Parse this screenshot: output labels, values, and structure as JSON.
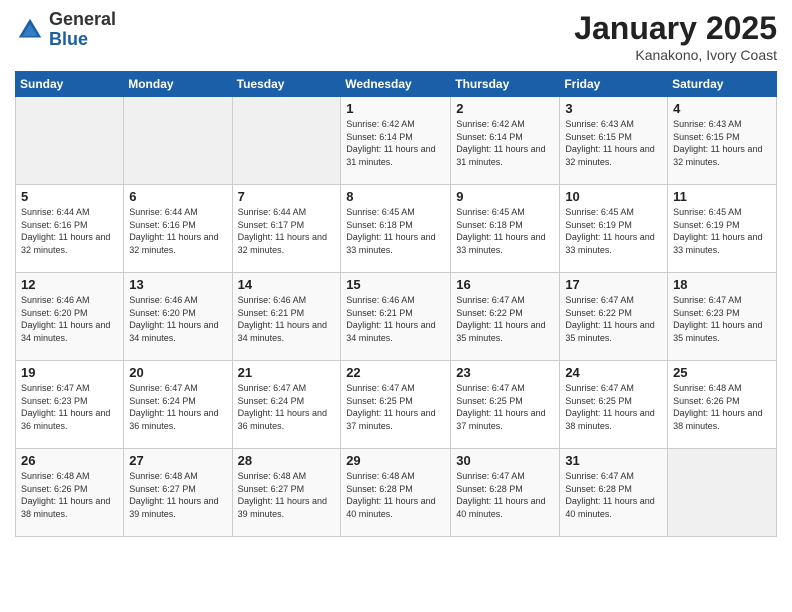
{
  "header": {
    "logo_line1": "General",
    "logo_line2": "Blue",
    "month": "January 2025",
    "location": "Kanakono, Ivory Coast"
  },
  "weekdays": [
    "Sunday",
    "Monday",
    "Tuesday",
    "Wednesday",
    "Thursday",
    "Friday",
    "Saturday"
  ],
  "weeks": [
    [
      {
        "day": "",
        "sunrise": "",
        "sunset": "",
        "daylight": ""
      },
      {
        "day": "",
        "sunrise": "",
        "sunset": "",
        "daylight": ""
      },
      {
        "day": "",
        "sunrise": "",
        "sunset": "",
        "daylight": ""
      },
      {
        "day": "1",
        "sunrise": "Sunrise: 6:42 AM",
        "sunset": "Sunset: 6:14 PM",
        "daylight": "Daylight: 11 hours and 31 minutes."
      },
      {
        "day": "2",
        "sunrise": "Sunrise: 6:42 AM",
        "sunset": "Sunset: 6:14 PM",
        "daylight": "Daylight: 11 hours and 31 minutes."
      },
      {
        "day": "3",
        "sunrise": "Sunrise: 6:43 AM",
        "sunset": "Sunset: 6:15 PM",
        "daylight": "Daylight: 11 hours and 32 minutes."
      },
      {
        "day": "4",
        "sunrise": "Sunrise: 6:43 AM",
        "sunset": "Sunset: 6:15 PM",
        "daylight": "Daylight: 11 hours and 32 minutes."
      }
    ],
    [
      {
        "day": "5",
        "sunrise": "Sunrise: 6:44 AM",
        "sunset": "Sunset: 6:16 PM",
        "daylight": "Daylight: 11 hours and 32 minutes."
      },
      {
        "day": "6",
        "sunrise": "Sunrise: 6:44 AM",
        "sunset": "Sunset: 6:16 PM",
        "daylight": "Daylight: 11 hours and 32 minutes."
      },
      {
        "day": "7",
        "sunrise": "Sunrise: 6:44 AM",
        "sunset": "Sunset: 6:17 PM",
        "daylight": "Daylight: 11 hours and 32 minutes."
      },
      {
        "day": "8",
        "sunrise": "Sunrise: 6:45 AM",
        "sunset": "Sunset: 6:18 PM",
        "daylight": "Daylight: 11 hours and 33 minutes."
      },
      {
        "day": "9",
        "sunrise": "Sunrise: 6:45 AM",
        "sunset": "Sunset: 6:18 PM",
        "daylight": "Daylight: 11 hours and 33 minutes."
      },
      {
        "day": "10",
        "sunrise": "Sunrise: 6:45 AM",
        "sunset": "Sunset: 6:19 PM",
        "daylight": "Daylight: 11 hours and 33 minutes."
      },
      {
        "day": "11",
        "sunrise": "Sunrise: 6:45 AM",
        "sunset": "Sunset: 6:19 PM",
        "daylight": "Daylight: 11 hours and 33 minutes."
      }
    ],
    [
      {
        "day": "12",
        "sunrise": "Sunrise: 6:46 AM",
        "sunset": "Sunset: 6:20 PM",
        "daylight": "Daylight: 11 hours and 34 minutes."
      },
      {
        "day": "13",
        "sunrise": "Sunrise: 6:46 AM",
        "sunset": "Sunset: 6:20 PM",
        "daylight": "Daylight: 11 hours and 34 minutes."
      },
      {
        "day": "14",
        "sunrise": "Sunrise: 6:46 AM",
        "sunset": "Sunset: 6:21 PM",
        "daylight": "Daylight: 11 hours and 34 minutes."
      },
      {
        "day": "15",
        "sunrise": "Sunrise: 6:46 AM",
        "sunset": "Sunset: 6:21 PM",
        "daylight": "Daylight: 11 hours and 34 minutes."
      },
      {
        "day": "16",
        "sunrise": "Sunrise: 6:47 AM",
        "sunset": "Sunset: 6:22 PM",
        "daylight": "Daylight: 11 hours and 35 minutes."
      },
      {
        "day": "17",
        "sunrise": "Sunrise: 6:47 AM",
        "sunset": "Sunset: 6:22 PM",
        "daylight": "Daylight: 11 hours and 35 minutes."
      },
      {
        "day": "18",
        "sunrise": "Sunrise: 6:47 AM",
        "sunset": "Sunset: 6:23 PM",
        "daylight": "Daylight: 11 hours and 35 minutes."
      }
    ],
    [
      {
        "day": "19",
        "sunrise": "Sunrise: 6:47 AM",
        "sunset": "Sunset: 6:23 PM",
        "daylight": "Daylight: 11 hours and 36 minutes."
      },
      {
        "day": "20",
        "sunrise": "Sunrise: 6:47 AM",
        "sunset": "Sunset: 6:24 PM",
        "daylight": "Daylight: 11 hours and 36 minutes."
      },
      {
        "day": "21",
        "sunrise": "Sunrise: 6:47 AM",
        "sunset": "Sunset: 6:24 PM",
        "daylight": "Daylight: 11 hours and 36 minutes."
      },
      {
        "day": "22",
        "sunrise": "Sunrise: 6:47 AM",
        "sunset": "Sunset: 6:25 PM",
        "daylight": "Daylight: 11 hours and 37 minutes."
      },
      {
        "day": "23",
        "sunrise": "Sunrise: 6:47 AM",
        "sunset": "Sunset: 6:25 PM",
        "daylight": "Daylight: 11 hours and 37 minutes."
      },
      {
        "day": "24",
        "sunrise": "Sunrise: 6:47 AM",
        "sunset": "Sunset: 6:25 PM",
        "daylight": "Daylight: 11 hours and 38 minutes."
      },
      {
        "day": "25",
        "sunrise": "Sunrise: 6:48 AM",
        "sunset": "Sunset: 6:26 PM",
        "daylight": "Daylight: 11 hours and 38 minutes."
      }
    ],
    [
      {
        "day": "26",
        "sunrise": "Sunrise: 6:48 AM",
        "sunset": "Sunset: 6:26 PM",
        "daylight": "Daylight: 11 hours and 38 minutes."
      },
      {
        "day": "27",
        "sunrise": "Sunrise: 6:48 AM",
        "sunset": "Sunset: 6:27 PM",
        "daylight": "Daylight: 11 hours and 39 minutes."
      },
      {
        "day": "28",
        "sunrise": "Sunrise: 6:48 AM",
        "sunset": "Sunset: 6:27 PM",
        "daylight": "Daylight: 11 hours and 39 minutes."
      },
      {
        "day": "29",
        "sunrise": "Sunrise: 6:48 AM",
        "sunset": "Sunset: 6:28 PM",
        "daylight": "Daylight: 11 hours and 40 minutes."
      },
      {
        "day": "30",
        "sunrise": "Sunrise: 6:47 AM",
        "sunset": "Sunset: 6:28 PM",
        "daylight": "Daylight: 11 hours and 40 minutes."
      },
      {
        "day": "31",
        "sunrise": "Sunrise: 6:47 AM",
        "sunset": "Sunset: 6:28 PM",
        "daylight": "Daylight: 11 hours and 40 minutes."
      },
      {
        "day": "",
        "sunrise": "",
        "sunset": "",
        "daylight": ""
      }
    ]
  ]
}
